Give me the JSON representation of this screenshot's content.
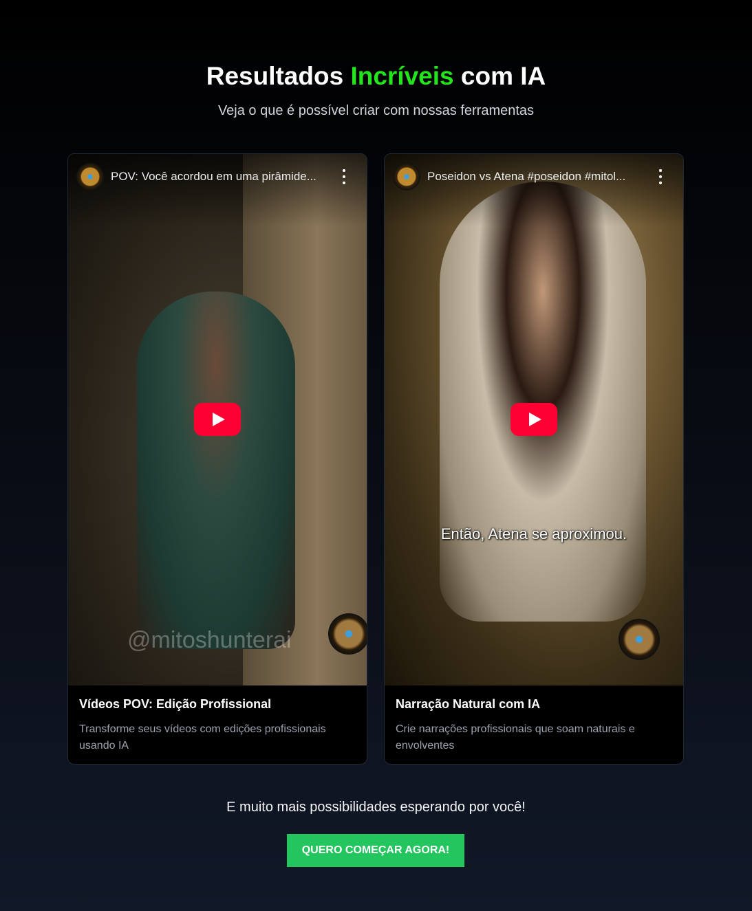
{
  "header": {
    "title_before": "Resultados ",
    "title_highlight": "Incríveis",
    "title_after": " com IA",
    "subtitle": "Veja o que é possível criar com nossas ferramentas",
    "highlight_color": "#22e51c"
  },
  "cards": [
    {
      "video_title": "POV: Você acordou em uma pirâmide...",
      "video_overlay_text": "@mitoshunterai",
      "heading": "Vídeos POV: Edição Profissional",
      "description": "Transforme seus vídeos com edições profissionais usando IA"
    },
    {
      "video_title": "Poseidon vs Atena #poseidon #mitol...",
      "video_overlay_text": "Então, Atena se aproximou.",
      "heading": "Narração Natural com IA",
      "description": "Crie narrações profissionais que soam naturais e envolventes"
    }
  ],
  "footer": {
    "more_text": "E muito mais possibilidades esperando por você!",
    "cta_label": "QUERO COMEÇAR AGORA!",
    "cta_color": "#22c55e"
  },
  "icons": {
    "play": "youtube-play-icon",
    "menu": "more-vertical-icon"
  }
}
